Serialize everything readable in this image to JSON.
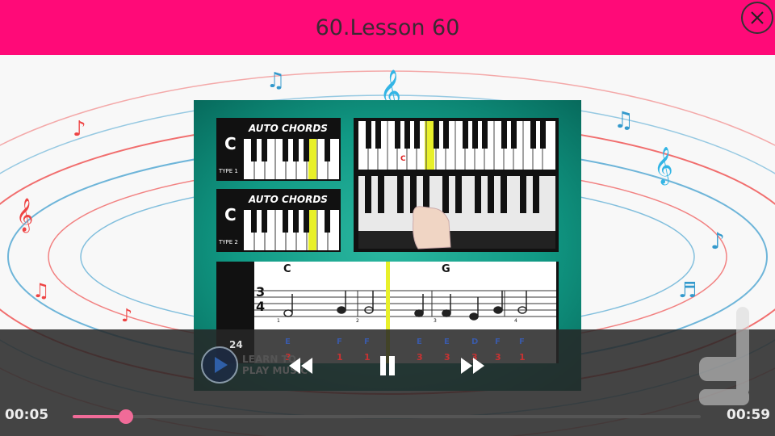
{
  "header": {
    "title": "60.Lesson 60",
    "background_color": "#ff0a78",
    "close_icon": "close-icon"
  },
  "video": {
    "panels": [
      {
        "label": "AUTO CHORDS",
        "chord": "C",
        "type": "TYPE 1"
      },
      {
        "label": "AUTO CHORDS",
        "chord": "C",
        "type": "TYPE 2"
      }
    ],
    "keyboard_note": "C",
    "score": {
      "chords": [
        "C",
        "G"
      ],
      "time_signature_top": "3",
      "time_signature_bottom": "4",
      "notes": [
        "E",
        "F",
        "F",
        "E",
        "E",
        "D",
        "F",
        "F"
      ],
      "fingers": [
        "3",
        "1",
        "1",
        "3",
        "3",
        "3",
        "3",
        "1"
      ],
      "measure_numbers": [
        "1",
        "2",
        "3",
        "4"
      ],
      "page_number": "24"
    },
    "logo_text_1": "LEARN TO",
    "logo_text_2": "PLAY MUSIC"
  },
  "player": {
    "current_time": "00:05",
    "duration": "00:59",
    "progress": 0.085,
    "accent_color": "#f06b98",
    "rewind_icon": "rewind-icon",
    "pause_icon": "pause-icon",
    "forward_icon": "fast-forward-icon"
  },
  "app_watermark_icon": "app-logo-icon"
}
